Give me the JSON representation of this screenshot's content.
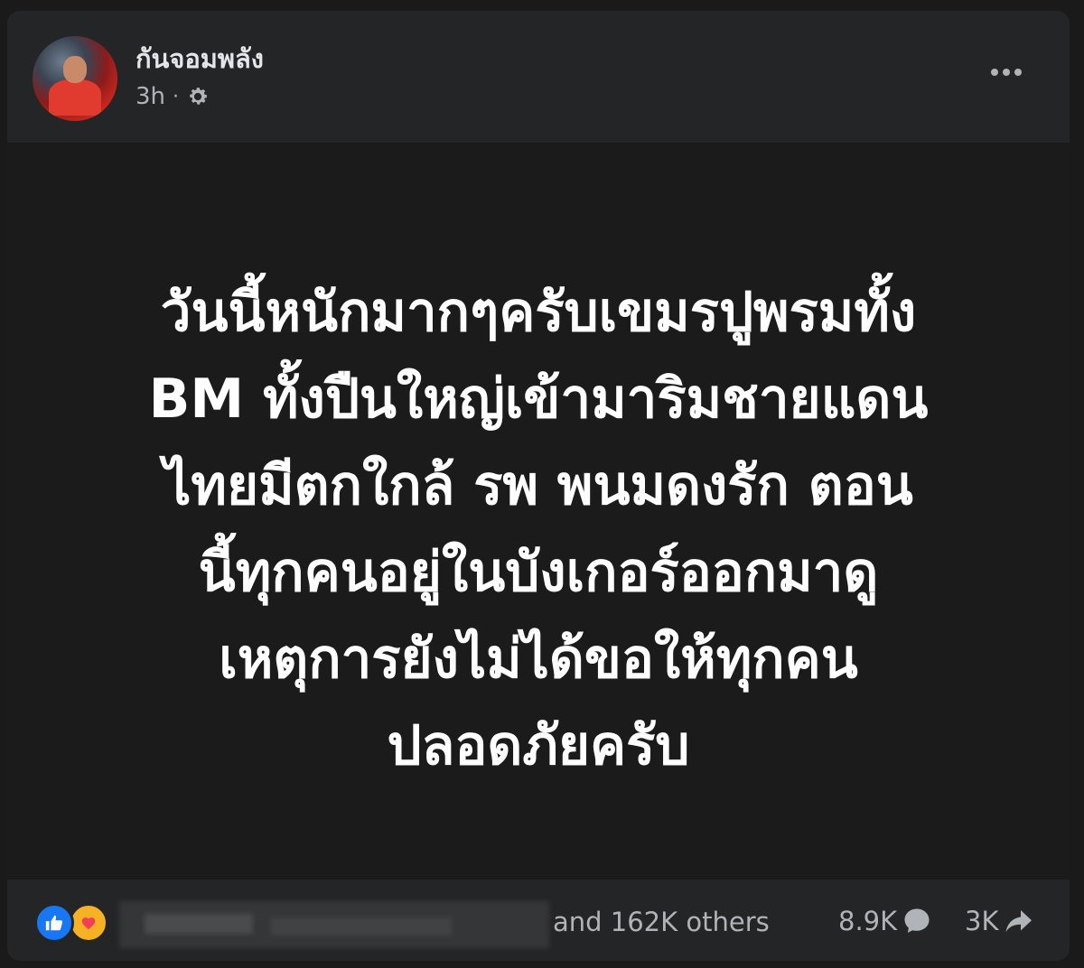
{
  "post": {
    "author": {
      "name": "กันจอมพลัง",
      "avatar_icon": "profile-photo"
    },
    "meta": {
      "time": "3h",
      "separator": "·",
      "audience_icon": "gear-icon"
    },
    "more_icon": "more-options-icon",
    "text": "วันนี้หนักมากๆครับเขมรปูพรมทั้ง\nBM ทั้งปืนใหญ่เข้ามาริมชายแดน\nไทยมีตกใกล้ รพ พนมดงรัก ตอน\nนี้ทุกคนอยู่ในบังเกอร์ออกมาดู\nเหตุการยังไม่ได้ขอให้ทุกคน\nปลอดภัยครับ"
  },
  "footer": {
    "reactions": {
      "icons": [
        "like-icon",
        "care-icon"
      ],
      "summary": "and 162K others"
    },
    "comments": {
      "count": "8.9K",
      "icon": "comment-icon"
    },
    "shares": {
      "count": "3K",
      "icon": "share-icon"
    }
  },
  "colors": {
    "card_background": "#242526",
    "body_background": "#1b1b1c",
    "text_primary": "#ffffff",
    "text_secondary": "#b0b3b8",
    "like_blue": "#1877f2",
    "care_yellow": "#f7b125"
  }
}
